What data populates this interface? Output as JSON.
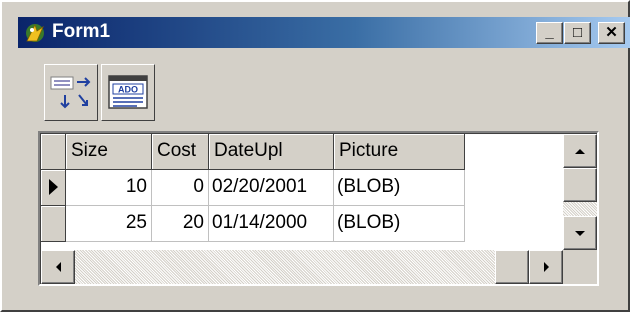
{
  "window": {
    "title": "Form1",
    "minimize_label": "_",
    "maximize_label": "□",
    "close_label": "✕"
  },
  "toolbar": {
    "buttons": [
      {
        "icon": "datasource-transfer-icon"
      },
      {
        "icon": "ado-dataset-icon",
        "text": "ADO"
      }
    ]
  },
  "grid": {
    "columns": [
      "Size",
      "Cost",
      "DateUpl",
      "Picture"
    ],
    "rows": [
      {
        "current": true,
        "cells": [
          "10",
          "0",
          "02/20/2001",
          "(BLOB)"
        ]
      },
      {
        "current": false,
        "cells": [
          "25",
          "20",
          "01/14/2000",
          "(BLOB)"
        ]
      }
    ]
  },
  "colors": {
    "title_gradient_start": "#0a246a",
    "title_gradient_end": "#a6caf0",
    "face": "#d4d0c8"
  }
}
